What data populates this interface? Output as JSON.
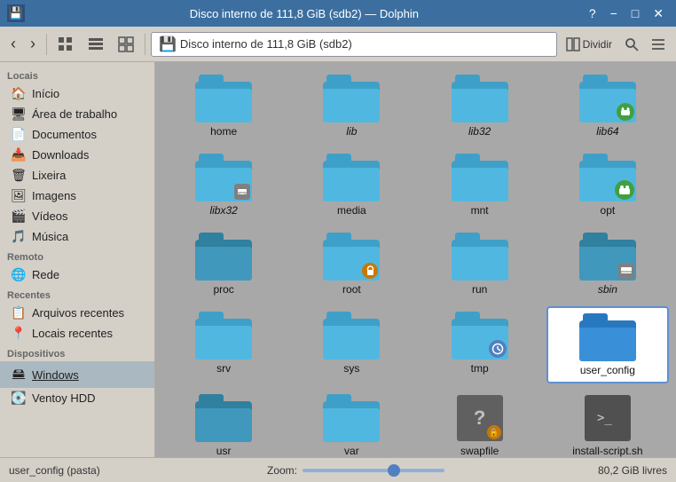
{
  "titlebar": {
    "icon": "💾",
    "title": "Disco interno de 111,8 GiB (sdb2) — Dolphin",
    "help_btn": "?",
    "minimize_btn": "−",
    "maximize_btn": "□",
    "close_btn": "✕"
  },
  "toolbar": {
    "back_btn": "‹",
    "forward_btn": "›",
    "view_icons_btn": "⊞",
    "view_list_btn": "☰",
    "view_compact_btn": "⊟",
    "location_text": "Disco interno de 111,8 GiB (sdb2)",
    "split_btn": "Dividir",
    "search_btn": "🔍",
    "menu_btn": "≡"
  },
  "sidebar": {
    "sections": [
      {
        "label": "Locais",
        "items": [
          {
            "id": "inicio",
            "icon": "🏠",
            "text": "Início"
          },
          {
            "id": "area-de-trabalho",
            "icon": "🖥",
            "text": "Área de trabalho"
          },
          {
            "id": "documentos",
            "icon": "📄",
            "text": "Documentos"
          },
          {
            "id": "downloads",
            "icon": "📥",
            "text": "Downloads"
          },
          {
            "id": "lixeira",
            "icon": "🗑",
            "text": "Lixeira"
          },
          {
            "id": "imagens",
            "icon": "🖼",
            "text": "Imagens"
          },
          {
            "id": "videos",
            "icon": "🎬",
            "text": "Vídeos"
          },
          {
            "id": "musica",
            "icon": "🎵",
            "text": "Música"
          }
        ]
      },
      {
        "label": "Remoto",
        "items": [
          {
            "id": "rede",
            "icon": "🌐",
            "text": "Rede"
          }
        ]
      },
      {
        "label": "Recentes",
        "items": [
          {
            "id": "arquivos-recentes",
            "icon": "📋",
            "text": "Arquivos recentes"
          },
          {
            "id": "locais-recentes",
            "icon": "📍",
            "text": "Locais recentes"
          }
        ]
      },
      {
        "label": "Dispositivos",
        "items": [
          {
            "id": "windows",
            "icon": "🖴",
            "text": "Windows",
            "active": true
          },
          {
            "id": "ventoy-hdd",
            "icon": "💽",
            "text": "Ventoy HDD"
          }
        ]
      }
    ]
  },
  "files": [
    {
      "id": "home",
      "name": "home",
      "type": "folder",
      "italic": false,
      "variant": "normal",
      "badge": null
    },
    {
      "id": "lib",
      "name": "lib",
      "type": "folder",
      "italic": true,
      "variant": "normal",
      "badge": null
    },
    {
      "id": "lib32",
      "name": "lib32",
      "type": "folder",
      "italic": true,
      "variant": "normal",
      "badge": null
    },
    {
      "id": "lib64",
      "name": "lib64",
      "type": "folder",
      "italic": true,
      "variant": "normal",
      "badge": null
    },
    {
      "id": "libx32",
      "name": "libx32",
      "type": "folder",
      "italic": true,
      "variant": "normal",
      "badge": null
    },
    {
      "id": "media",
      "name": "media",
      "type": "folder",
      "italic": false,
      "variant": "normal",
      "badge": null
    },
    {
      "id": "mnt",
      "name": "mnt",
      "type": "folder",
      "italic": false,
      "variant": "normal",
      "badge": null
    },
    {
      "id": "opt",
      "name": "opt",
      "type": "folder",
      "italic": false,
      "variant": "android",
      "badge": null
    },
    {
      "id": "proc",
      "name": "proc",
      "type": "folder",
      "italic": false,
      "variant": "normal",
      "badge": null
    },
    {
      "id": "root",
      "name": "root",
      "type": "folder",
      "italic": false,
      "variant": "normal",
      "badge": "lock"
    },
    {
      "id": "run",
      "name": "run",
      "type": "folder",
      "italic": false,
      "variant": "normal",
      "badge": null
    },
    {
      "id": "sbin",
      "name": "sbin",
      "type": "folder",
      "italic": true,
      "variant": "sbin",
      "badge": null
    },
    {
      "id": "srv",
      "name": "srv",
      "type": "folder",
      "italic": false,
      "variant": "normal",
      "badge": null
    },
    {
      "id": "sys",
      "name": "sys",
      "type": "folder",
      "italic": false,
      "variant": "normal",
      "badge": null
    },
    {
      "id": "tmp",
      "name": "tmp",
      "type": "folder",
      "italic": false,
      "variant": "clock",
      "badge": null
    },
    {
      "id": "user_config",
      "name": "user_config",
      "type": "folder",
      "italic": false,
      "variant": "selected",
      "badge": null
    },
    {
      "id": "usr",
      "name": "usr",
      "type": "folder",
      "italic": false,
      "variant": "dark",
      "badge": null
    },
    {
      "id": "var",
      "name": "var",
      "type": "folder",
      "italic": false,
      "variant": "normal",
      "badge": null
    },
    {
      "id": "swapfile",
      "name": "swapfile",
      "type": "swap",
      "italic": false
    },
    {
      "id": "install-script.sh",
      "name": "install-script.sh",
      "type": "script",
      "italic": false
    }
  ],
  "statusbar": {
    "status_text": "user_config (pasta)",
    "zoom_label": "Zoom:",
    "free_space": "80,2 GiB livres"
  }
}
